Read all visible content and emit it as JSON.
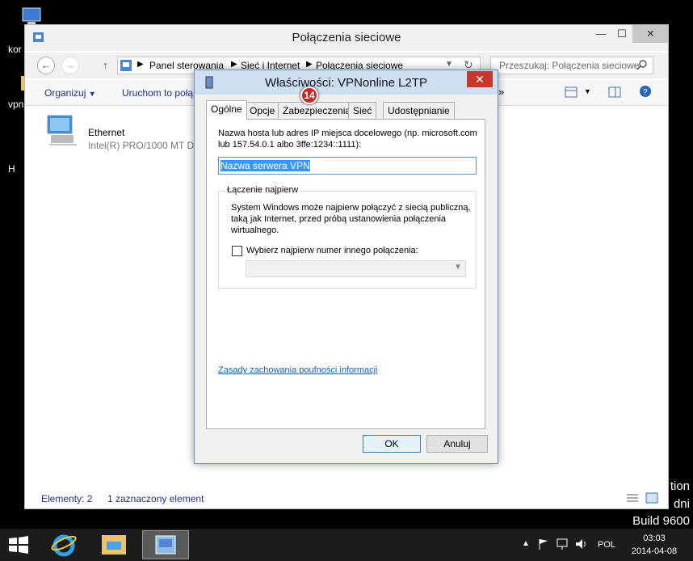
{
  "desktop": {
    "labels": [
      "kor",
      "vpn",
      "H"
    ],
    "watermark": [
      "tion",
      "dni",
      "Build 9600"
    ]
  },
  "explorer": {
    "title": "Połączenia sieciowe",
    "breadcrumb": [
      "Panel sterowania",
      "Sieć i Internet",
      "Połączenia sieciowe"
    ],
    "search_placeholder": "Przeszukaj: Połączenia sieciowe",
    "toolbar": {
      "organize": "Organizuj",
      "launch": "Uruchom to połą"
    },
    "item": {
      "name": "Ethernet",
      "device": "Intel(R) PRO/1000 MT De"
    },
    "status": {
      "count": "Elementy: 2",
      "selected": "1 zaznaczony element"
    }
  },
  "dialog": {
    "title": "Właściwości: VPNonline L2TP",
    "badge": "14",
    "tabs": [
      "Ogólne",
      "Opcje",
      "Zabezpieczenia",
      "Sieć",
      "Udostępnianie"
    ],
    "host_label_1": "Nazwa hosta lub adres IP miejsca docelowego (np. microsoft.com",
    "host_label_2": "lub 157.54.0.1 albo 3ffe:1234::1111):",
    "host_value": "Nazwa serwera VPN",
    "group_title": "Łączenie najpierw",
    "group_text_1": "System Windows może najpierw połączyć z siecią publiczną,",
    "group_text_2": "taką jak Internet, przed próbą ustanowienia połączenia",
    "group_text_3": "wirtualnego.",
    "checkbox_label": "Wybierz najpierw numer innego połączenia:",
    "privacy_link": "Zasady zachowania poufności informacji",
    "ok": "OK",
    "cancel": "Anuluj"
  },
  "taskbar": {
    "language": "POL",
    "time": "03:03",
    "date": "2014-04-08"
  }
}
